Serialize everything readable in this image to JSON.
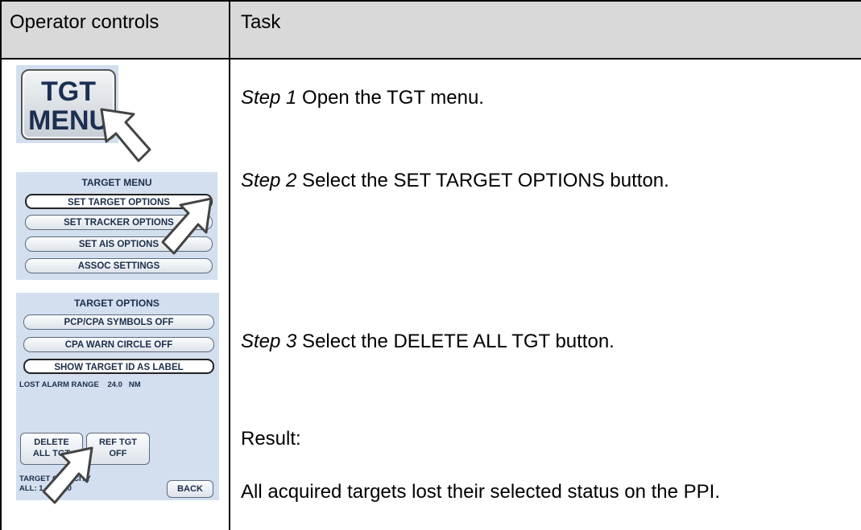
{
  "header": {
    "col1": "Operator controls",
    "col2": "Task"
  },
  "steps": [
    {
      "label": "Step 1",
      "text": " Open the TGT menu."
    },
    {
      "label": "Step 2",
      "text": " Select the SET TARGET OPTIONS button."
    },
    {
      "label": "Step 3",
      "text": " Select the DELETE ALL TGT button."
    }
  ],
  "result": {
    "label": "Result:",
    "text": "All acquired targets lost their selected status on the PPI."
  },
  "tgt_menu_button": {
    "line1": "TGT",
    "line2": "MENU"
  },
  "target_menu": {
    "title": "TARGET MENU",
    "buttons": [
      "SET TARGET OPTIONS",
      "SET TRACKER OPTIONS",
      "SET AIS OPTIONS",
      "ASSOC SETTINGS"
    ]
  },
  "target_options": {
    "title": "TARGET OPTIONS",
    "buttons": [
      "PCP/CPA SYMBOLS OFF",
      "CPA WARN CIRCLE OFF",
      "SHOW TARGET ID AS LABEL"
    ],
    "lost_alarm_label": "LOST ALARM RANGE",
    "lost_alarm_value": "24.0",
    "lost_alarm_unit": "NM",
    "delete_all": {
      "line1": "DELETE",
      "line2": "ALL TGT"
    },
    "ref_tgt": {
      "line1": "REF TGT",
      "line2": "OFF"
    },
    "capacity_label": "TARGET CAPACITY",
    "capacity_value": "ALL: 1 of 7__0",
    "back": "BACK"
  },
  "colors": {
    "panel_bg": "#d3dfee",
    "header_bg": "#d9d9d9",
    "button_text": "#1b2e4b"
  }
}
